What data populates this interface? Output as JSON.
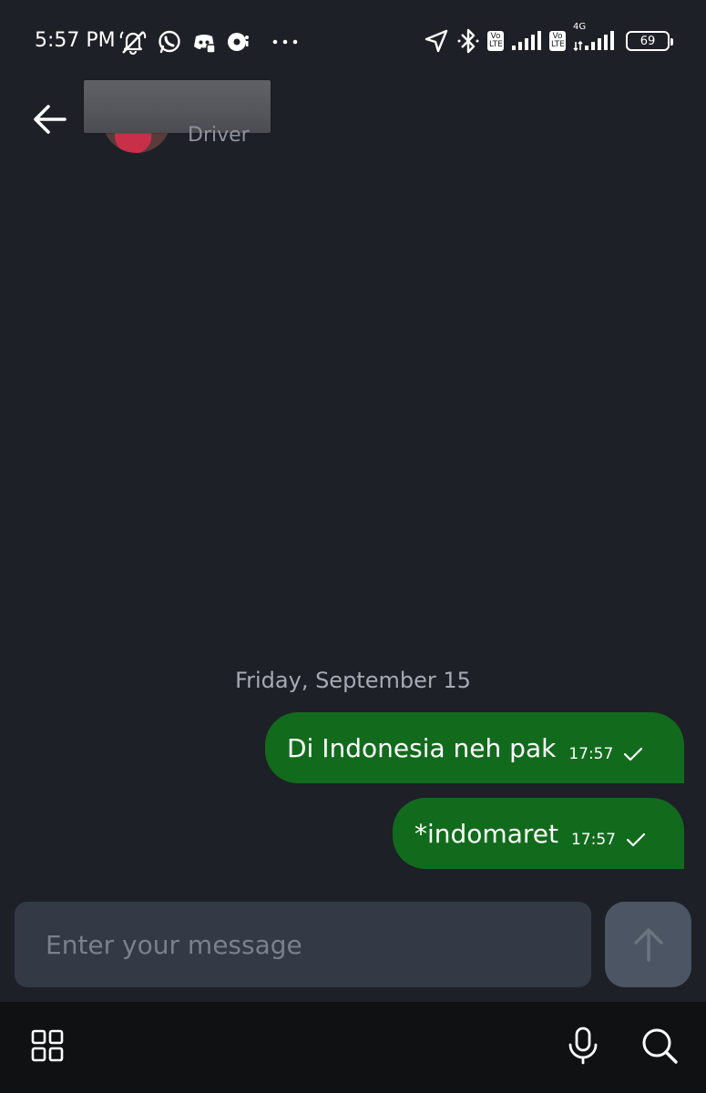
{
  "status_bar": {
    "time": "5:57 PM",
    "battery_level": "69",
    "volte_label_1": "Vo LTE",
    "volte_label_2": "Vo LTE",
    "network_type": "4G",
    "icons": [
      "muted-bell-icon",
      "whatsapp-icon",
      "discord-icon",
      "disc-app-icon",
      "more-dots-icon",
      "location-arrow-icon",
      "bluetooth-icon",
      "signal-icon",
      "battery-icon"
    ]
  },
  "header": {
    "contact_role": "Driver"
  },
  "chat": {
    "date_divider": "Friday, September 15",
    "messages": [
      {
        "text": "Di Indonesia neh pak",
        "time": "17:57",
        "status": "sent"
      },
      {
        "text": "*indomaret",
        "time": "17:57",
        "status": "sent"
      }
    ]
  },
  "composer": {
    "placeholder": "Enter your message",
    "value": ""
  },
  "colors": {
    "background": "#1d2026",
    "bubble": "#126b1d",
    "composer": "#333a45",
    "send_button": "#4b5563",
    "bottom_bar": "#101113"
  }
}
